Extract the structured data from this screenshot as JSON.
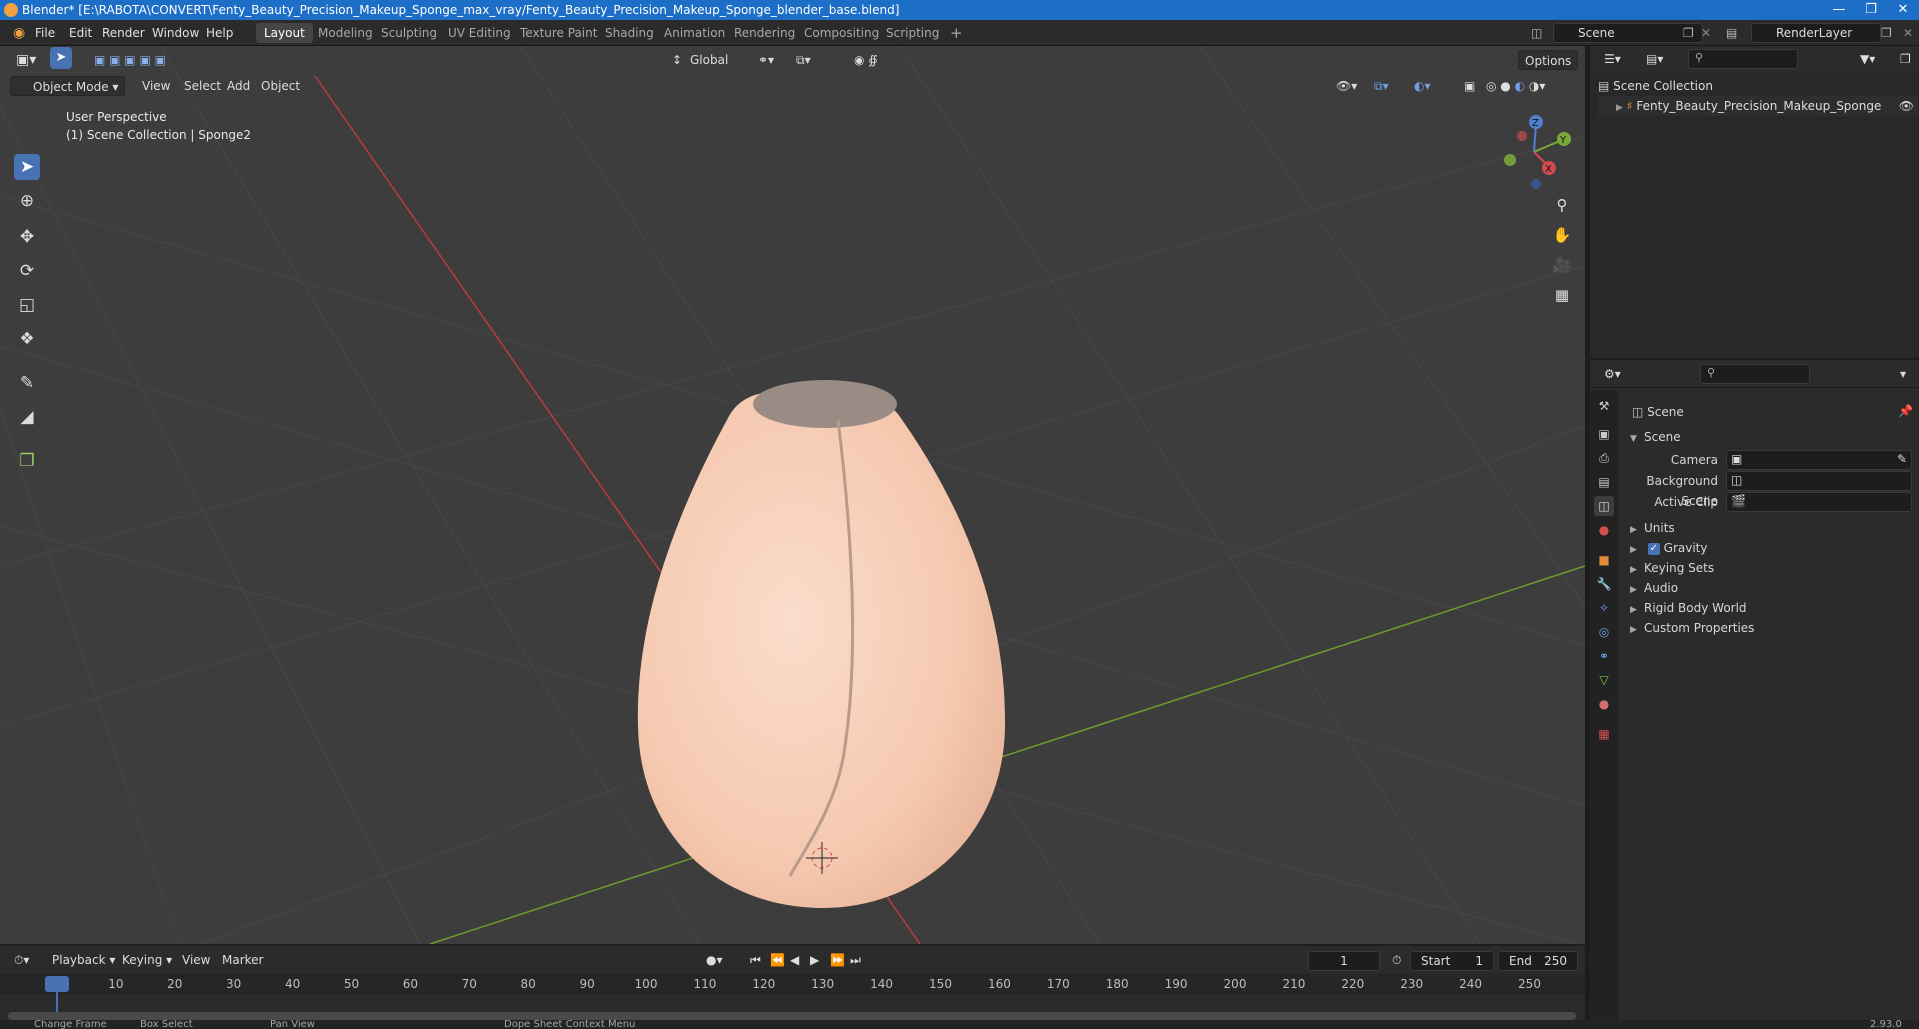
{
  "window": {
    "title": "Blender* [E:\\RABOTA\\CONVERT\\Fenty_Beauty_Precision_Makeup_Sponge_max_vray/Fenty_Beauty_Precision_Makeup_Sponge_blender_base.blend]"
  },
  "menus": [
    "File",
    "Edit",
    "Render",
    "Window",
    "Help"
  ],
  "workspaces": [
    "Layout",
    "Modeling",
    "Sculpting",
    "UV Editing",
    "Texture Paint",
    "Shading",
    "Animation",
    "Rendering",
    "Compositing",
    "Scripting"
  ],
  "active_workspace": "Layout",
  "scene_field": "Scene",
  "renderlayer_field": "RenderLayer",
  "viewport": {
    "mode": "Object Mode",
    "menus": [
      "View",
      "Select",
      "Add",
      "Object"
    ],
    "orientation": "Global",
    "options": "Options",
    "info_line1": "User Perspective",
    "info_line2": "(1) Scene Collection | Sponge2",
    "gizmo": {
      "x": "X",
      "y": "Y",
      "z": "Z"
    }
  },
  "outliner": {
    "root": "Scene Collection",
    "items": [
      {
        "label": "Fenty_Beauty_Precision_Makeup_Sponge"
      }
    ]
  },
  "properties": {
    "header": "Scene",
    "panel": "Scene",
    "camera_label": "Camera",
    "bg_scene_label": "Background Scene",
    "active_clip_label": "Active Clip",
    "sections": [
      "Units",
      "Gravity",
      "Keying Sets",
      "Audio",
      "Rigid Body World",
      "Custom Properties"
    ],
    "gravity_checked": true
  },
  "timeline": {
    "menus": [
      "Playback",
      "Keying",
      "View",
      "Marker"
    ],
    "current_frame": "1",
    "start_label": "Start",
    "start": "1",
    "end_label": "End",
    "end": "250",
    "ticks": [
      "1",
      "10",
      "20",
      "30",
      "40",
      "50",
      "60",
      "70",
      "80",
      "90",
      "100",
      "110",
      "120",
      "130",
      "140",
      "150",
      "160",
      "170",
      "180",
      "190",
      "200",
      "210",
      "220",
      "230",
      "240",
      "250"
    ]
  },
  "statusbar": {
    "items": [
      "Change Frame",
      "Box Select",
      "Pan View",
      "Dope Sheet Context Menu"
    ],
    "version": "2.93.0"
  },
  "colors": {
    "accent": "#4772b3",
    "title_bar": "#1d6ec6",
    "x_axis": "#c83c3c",
    "y_axis": "#6e9b2a",
    "sponge": "#f5cdb5"
  }
}
